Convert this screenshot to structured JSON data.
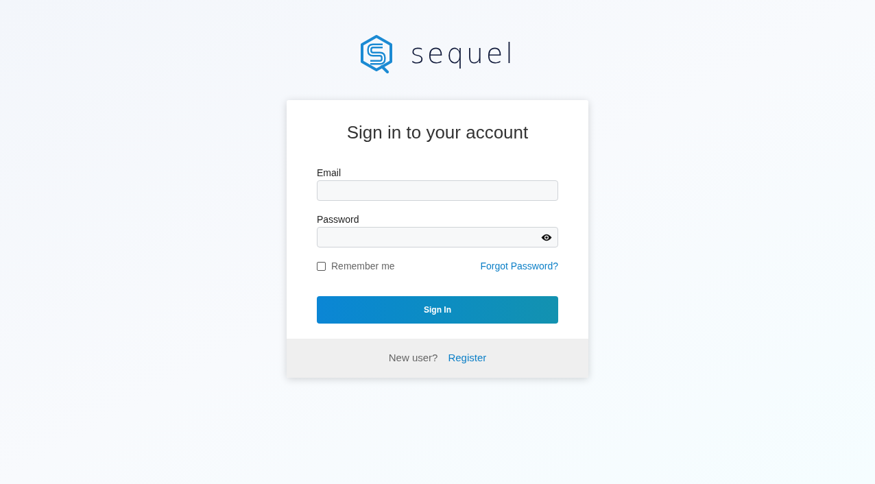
{
  "logo": {
    "name": "sequel"
  },
  "card": {
    "title": "Sign in to your account",
    "fields": [
      {
        "label": "Email",
        "kind": "text"
      },
      {
        "label": "Password",
        "kind": "password"
      }
    ],
    "remember": {
      "label": "Remember me",
      "checked": false
    },
    "forgot_link": "Forgot Password?",
    "submit": "Sign In",
    "footer": {
      "text": "New user?",
      "link": "Register"
    }
  }
}
